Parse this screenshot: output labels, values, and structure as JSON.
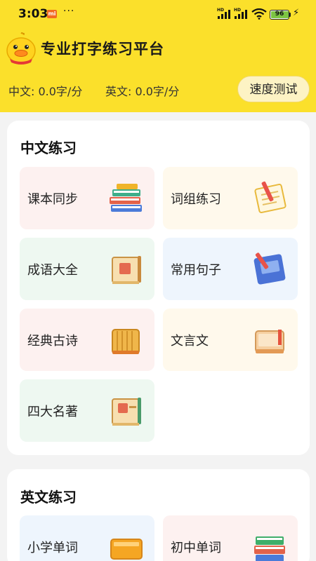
{
  "status_bar": {
    "time": "3:03",
    "carrier_badge": "mi",
    "more": "···",
    "hd1": "HD",
    "hd2": "HD",
    "battery": "96"
  },
  "header": {
    "title": "专业打字练习平台",
    "speed_chinese": "中文: 0.0字/分",
    "speed_english": "英文: 0.0字/分",
    "speed_test_button": "速度测试"
  },
  "chinese_section": {
    "title": "中文练习",
    "items": [
      {
        "label": "课本同步",
        "icon": "book-stack-icon"
      },
      {
        "label": "词组练习",
        "icon": "notepad-pencil-icon"
      },
      {
        "label": "成语大全",
        "icon": "scroll-book-icon"
      },
      {
        "label": "常用句子",
        "icon": "blue-notebook-icon"
      },
      {
        "label": "经典古诗",
        "icon": "bamboo-book-icon"
      },
      {
        "label": "文言文",
        "icon": "classic-book-icon"
      },
      {
        "label": "四大名著",
        "icon": "masterpiece-book-icon"
      }
    ]
  },
  "english_section": {
    "title": "英文练习",
    "items": [
      {
        "label": "小学单词",
        "icon": "orange-book-icon"
      },
      {
        "label": "初中单词",
        "icon": "green-book-stack-icon"
      }
    ]
  },
  "colors": {
    "header_bg": "#fbe02b",
    "tile_pink": "#fdf1f0",
    "tile_cream": "#fff9ec",
    "tile_mint": "#eef8f1",
    "tile_blue": "#eef5fd"
  }
}
